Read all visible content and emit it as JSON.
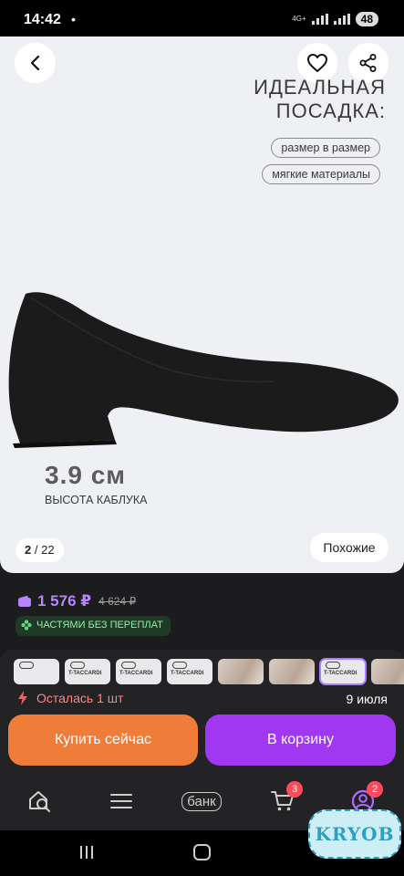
{
  "status_bar": {
    "time": "14:42",
    "dot": "•",
    "network": "4G+",
    "battery": "48"
  },
  "product_image": {
    "promo_heading": "ИДЕАЛЬНАЯ\nПОСАДКА:",
    "pills": [
      "размер в размер",
      "мягкие материалы"
    ],
    "heel_height_value": "3.9 см",
    "heel_height_label": "ВЫСОТА КАБЛУКА",
    "counter_current": "2",
    "counter_total": "/ 22",
    "similar_label": "Похожие",
    "icons": {
      "back": "chevron-left-icon",
      "favorite": "heart-icon",
      "share": "share-icon"
    }
  },
  "price": {
    "current": "1 576 ₽",
    "old": "4 624 ₽",
    "installment_badge": "ЧАСТЯМИ БЕЗ ПЕРЕПЛАТ",
    "colors": {
      "price": "#b584ff",
      "badge_text": "#8ff0a4"
    }
  },
  "variants": {
    "brand_text": "T-TACCARDI",
    "count_visible": 8,
    "selected_index": 6
  },
  "availability": {
    "stock_text": "Осталась 1 шт",
    "delivery_date": "9 июля"
  },
  "actions": {
    "buy_now": "Купить сейчас",
    "add_to_cart": "В корзину",
    "colors": {
      "buy_now": "#f07c3a",
      "add_to_cart": "#a038f2"
    }
  },
  "tab_bar": {
    "items": [
      {
        "name": "search",
        "icon": "search-home-icon"
      },
      {
        "name": "catalog",
        "icon": "menu-icon"
      },
      {
        "name": "bank",
        "label": "банк"
      },
      {
        "name": "cart",
        "icon": "cart-icon",
        "badge": "3"
      },
      {
        "name": "profile",
        "icon": "profile-icon",
        "badge": "2"
      }
    ]
  },
  "watermark": {
    "text": "KRYOB"
  }
}
